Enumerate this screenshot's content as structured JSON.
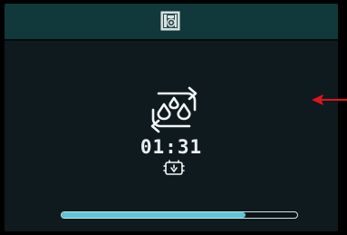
{
  "header": {
    "icon": "washing-machine-icon"
  },
  "program": {
    "icon": "water-cycle-icon",
    "remaining_time": "01:31",
    "mode_icon": "wash-tub-icon"
  },
  "progress": {
    "value": 0.78
  },
  "annotation": {
    "icon": "red-pointer-arrow"
  },
  "colors": {
    "header_bg": "#11383a",
    "screen_bg": "#0f1a1e",
    "progress_fill": "#5ec6d7",
    "text": "#e9eeee",
    "pointer": "#e0141e"
  }
}
